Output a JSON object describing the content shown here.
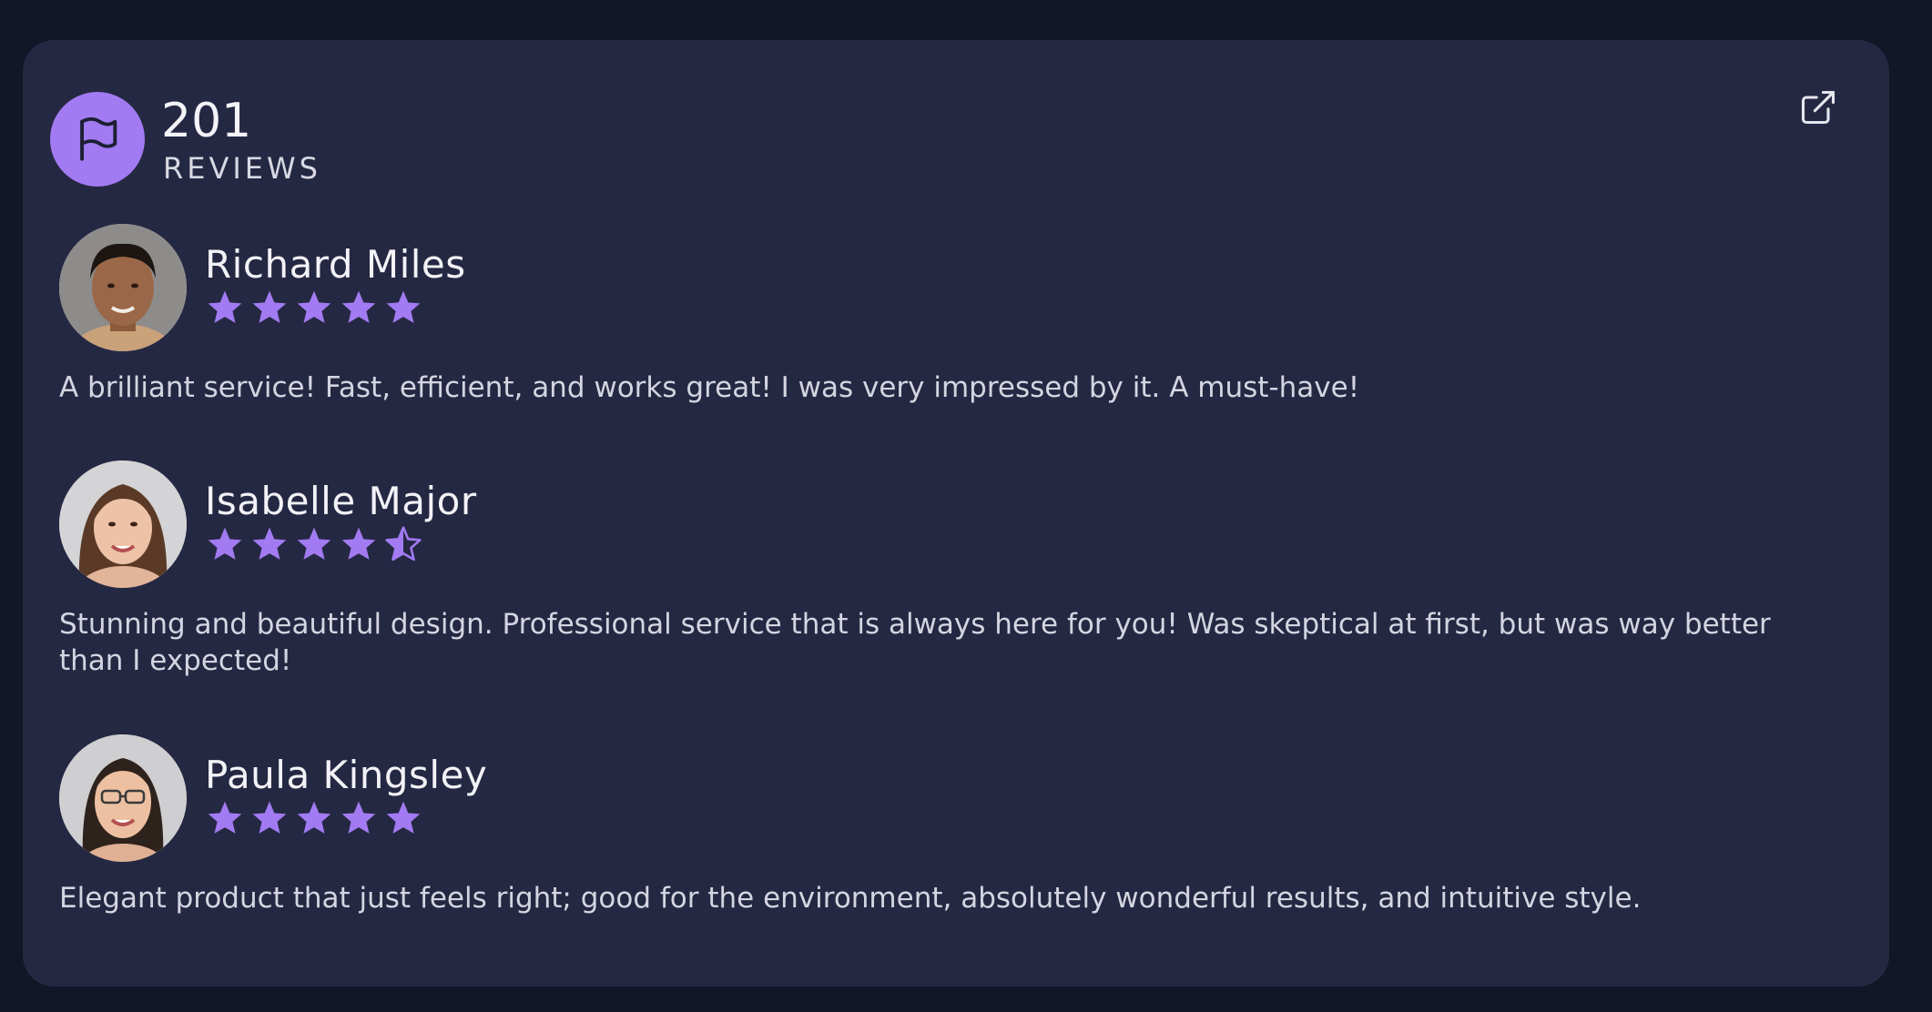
{
  "summary": {
    "count": "201",
    "label": "REVIEWS",
    "icon": "flag-icon"
  },
  "header_action": {
    "icon": "external-link-icon"
  },
  "colors": {
    "accent": "#a27bf3",
    "card_bg": "#252842",
    "page_bg": "#121626"
  },
  "reviews": [
    {
      "name": "Richard Miles",
      "rating": 5,
      "text": "A brilliant service! Fast, efficient, and works great! I was very impressed by it. A must-have!"
    },
    {
      "name": "Isabelle Major",
      "rating": 4.5,
      "text": "Stunning and beautiful design. Professional service that is always here for you! Was skeptical at first, but was way better than I expected!"
    },
    {
      "name": "Paula Kingsley",
      "rating": 5,
      "text": "Elegant product that just feels right; good for the environment, absolutely wonderful results, and intuitive style."
    }
  ]
}
